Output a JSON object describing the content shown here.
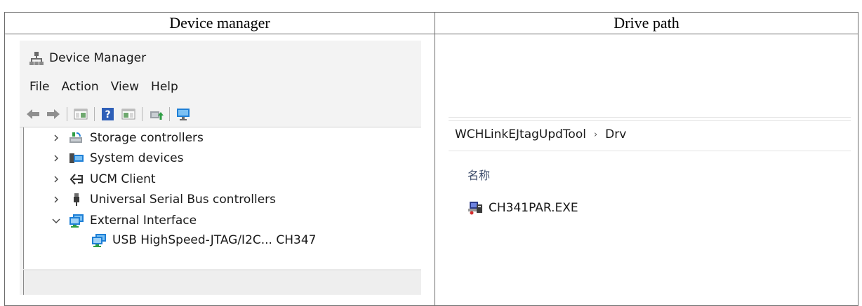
{
  "table": {
    "col_left_header": "Device manager",
    "col_right_header": "Drive path"
  },
  "device_manager": {
    "title": "Device Manager",
    "menu": [
      "File",
      "Action",
      "View",
      "Help"
    ],
    "toolbar_icons": [
      "back-arrow-icon",
      "forward-arrow-icon",
      "properties-pane-icon",
      "help-icon",
      "show-hide-icon",
      "update-driver-icon",
      "scan-hardware-icon"
    ],
    "tree": [
      {
        "label": "Storage controllers",
        "expanded": false,
        "icon": "storage-controller-icon"
      },
      {
        "label": "System devices",
        "expanded": false,
        "icon": "system-devices-icon"
      },
      {
        "label": "UCM Client",
        "expanded": false,
        "icon": "ucm-client-icon"
      },
      {
        "label": "Universal Serial Bus controllers",
        "expanded": false,
        "icon": "usb-icon"
      },
      {
        "label": "External Interface",
        "expanded": true,
        "icon": "external-interface-icon"
      }
    ],
    "child": {
      "label": "USB HighSpeed-JTAG/I2C... CH347",
      "icon": "network-device-icon"
    }
  },
  "drive_path": {
    "breadcrumb": [
      "WCHLinkEJtagUpdTool",
      "Drv"
    ],
    "column_header": "名称",
    "file": {
      "name": "CH341PAR.EXE",
      "icon": "installer-exe-icon"
    }
  },
  "colors": {
    "border": "#6d6d6d",
    "window_bg": "#f3f3f3",
    "help_blue": "#2e5fb8",
    "monitor_blue": "#1e7fd6"
  }
}
